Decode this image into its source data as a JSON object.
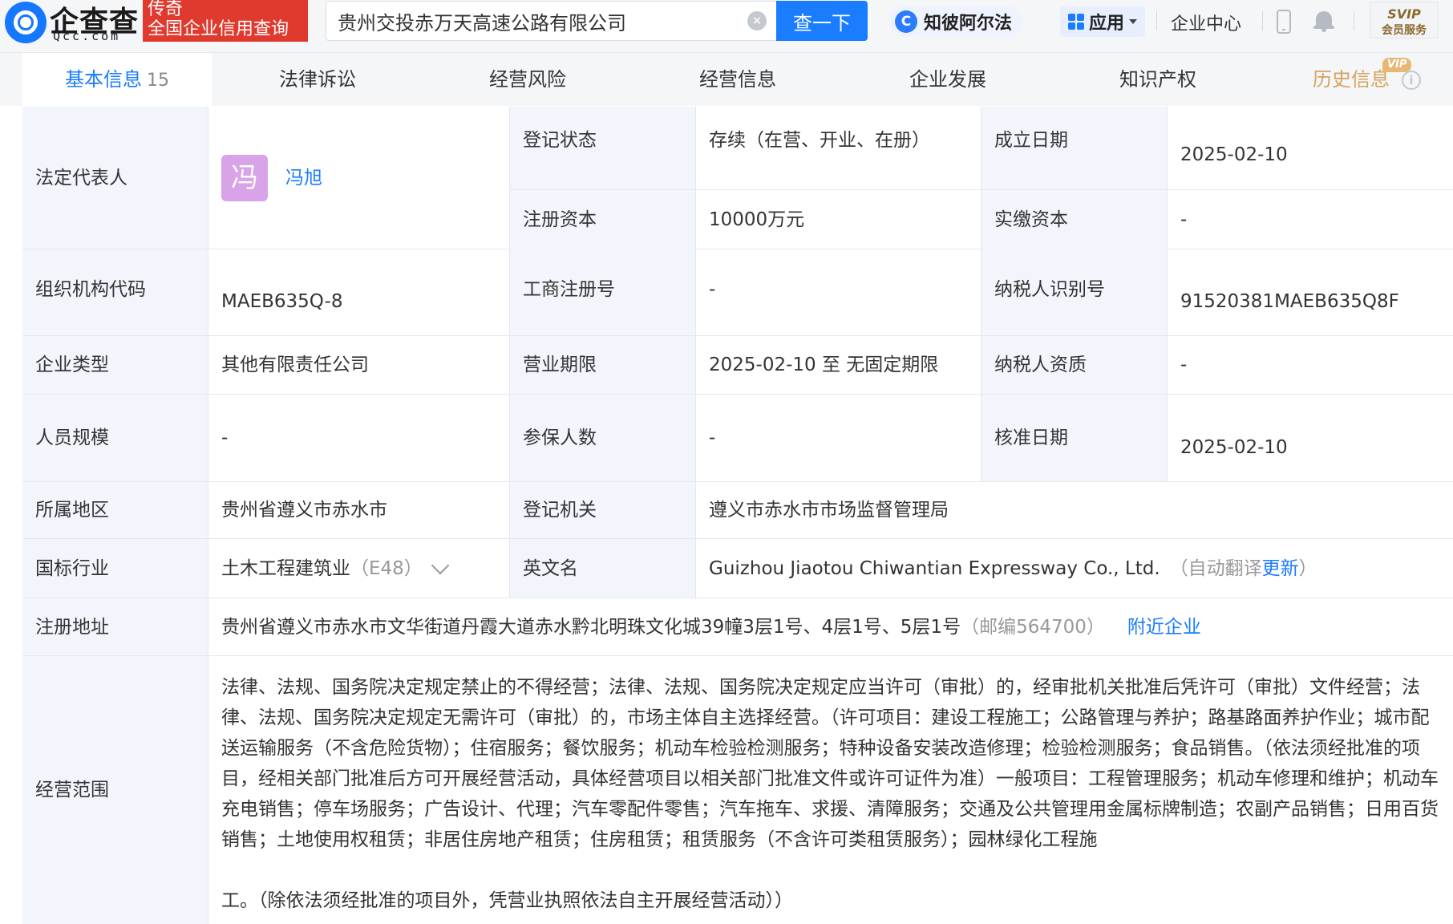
{
  "header": {
    "logo_name": "企查查",
    "logo_domain": "Qcc.com",
    "slogan_line1": "传奇",
    "slogan_line2": "全国企业信用查询",
    "search_value": "贵州交投赤万天高速公路有限公司",
    "clear_glyph": "✕",
    "search_button": "查一下",
    "zhibi_glyph": "C",
    "zhibi_label": "知彼阿尔法",
    "apps_label": "应用",
    "enterprise_center": "企业中心",
    "svip_top": "SVIP",
    "svip_bottom": "会员服务"
  },
  "tabs": [
    {
      "label": "基本信息",
      "count": "15"
    },
    {
      "label": "法律诉讼"
    },
    {
      "label": "经营风险"
    },
    {
      "label": "经营信息"
    },
    {
      "label": "企业发展"
    },
    {
      "label": "知识产权"
    },
    {
      "label": "历史信息",
      "badge": "VIP",
      "info_glyph": "i"
    }
  ],
  "rows": {
    "legal_rep": {
      "label": "法定代表人",
      "avatar_char": "冯",
      "name": "冯旭"
    },
    "reg_status": {
      "label": "登记状态",
      "value": "存续（在营、开业、在册）"
    },
    "founded": {
      "label": "成立日期",
      "value": "2025-02-10"
    },
    "reg_capital": {
      "label": "注册资本",
      "value": "10000万元"
    },
    "paid_capital": {
      "label": "实缴资本",
      "value": "-"
    },
    "org_code": {
      "label": "组织机构代码",
      "value": "MAEB635Q-8"
    },
    "biz_reg_no": {
      "label": "工商注册号",
      "value": "-"
    },
    "tax_id": {
      "label": "纳税人识别号",
      "value": "91520381MAEB635Q8F"
    },
    "company_type": {
      "label": "企业类型",
      "value": "其他有限责任公司"
    },
    "biz_term": {
      "label": "营业期限",
      "value": "2025-02-10 至 无固定期限"
    },
    "taxpayer_qual": {
      "label": "纳税人资质",
      "value": "-"
    },
    "staff_size": {
      "label": "人员规模",
      "value": "-"
    },
    "insured": {
      "label": "参保人数",
      "value": "-"
    },
    "approval_date": {
      "label": "核准日期",
      "value": "2025-02-10"
    },
    "region": {
      "label": "所属地区",
      "value": "贵州省遵义市赤水市"
    },
    "reg_authority": {
      "label": "登记机关",
      "value": "遵义市赤水市市场监督管理局"
    },
    "industry": {
      "label": "国标行业",
      "value": "土木工程建筑业",
      "code": "（E48）"
    },
    "english_name": {
      "label": "英文名",
      "value": "Guizhou Jiaotou Chiwantian Expressway Co., Ltd.",
      "note_prefix": "（自动翻译",
      "update_link": "更新",
      "note_suffix": "）"
    },
    "address": {
      "label": "注册地址",
      "value": "贵州省遵义市赤水市文华街道丹霞大道赤水黔北明珠文化城39幢3层1号、4层1号、5层1号",
      "postcode": "（邮编564700）",
      "nearby_link": "附近企业"
    },
    "scope": {
      "label": "经营范围",
      "para1": "法律、法规、国务院决定规定禁止的不得经营；法律、法规、国务院决定规定应当许可（审批）的，经审批机关批准后凭许可（审批）文件经营；法律、法规、国务院决定规定无需许可（审批）的，市场主体自主选择经营。（许可项目：建设工程施工；公路管理与养护；路基路面养护作业；城市配送运输服务（不含危险货物）；住宿服务；餐饮服务；机动车检验检测服务；特种设备安装改造修理；检验检测服务；食品销售。（依法须经批准的项目，经相关部门批准后方可开展经营活动，具体经营项目以相关部门批准文件或许可证件为准）一般项目：工程管理服务；机动车修理和维护；机动车充电销售；停车场服务；广告设计、代理；汽车零配件零售；汽车拖车、求援、清障服务；交通及公共管理用金属标牌制造；农副产品销售；日用百货销售；土地使用权租赁；非居住房地产租赁；住房租赁；租赁服务（不含许可类租赁服务）；园林绿化工程施",
      "para2": "工。（除依法须经批准的项目外，凭营业执照依法自主开展经营活动））"
    }
  }
}
